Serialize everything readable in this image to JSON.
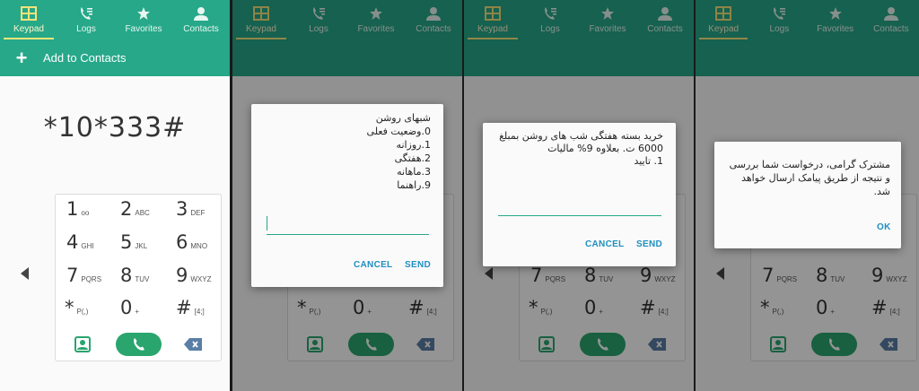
{
  "tabs": [
    {
      "label": "Keypad",
      "icon": "keypad-icon",
      "active": true
    },
    {
      "label": "Logs",
      "icon": "call-log-icon",
      "active": false
    },
    {
      "label": "Favorites",
      "icon": "star-icon",
      "active": false
    },
    {
      "label": "Contacts",
      "icon": "person-icon",
      "active": false
    }
  ],
  "actionbar": {
    "label": "Add to Contacts",
    "icon": "plus-icon"
  },
  "dial_number": "*10*333#",
  "keys": [
    {
      "digit": "1",
      "sub": "ᴏᴏ"
    },
    {
      "digit": "2",
      "sub": "ABC"
    },
    {
      "digit": "3",
      "sub": "DEF"
    },
    {
      "digit": "4",
      "sub": "GHI"
    },
    {
      "digit": "5",
      "sub": "JKL"
    },
    {
      "digit": "6",
      "sub": "MNO"
    },
    {
      "digit": "7",
      "sub": "PQRS"
    },
    {
      "digit": "8",
      "sub": "TUV"
    },
    {
      "digit": "9",
      "sub": "WXYZ"
    },
    {
      "digit": "*",
      "sub": "P(,)"
    },
    {
      "digit": "0",
      "sub": "+"
    },
    {
      "digit": "#",
      "sub": "[4;]"
    }
  ],
  "dialog1": {
    "message": "شبهای روشن\n0.وضعیت فعلی\n1.روزانه\n2.هفتگی\n3.ماهانه\n9.راهنما",
    "cancel": "CANCEL",
    "send": "SEND"
  },
  "dialog2": {
    "message": "خرید بسته هفتگی شب های روشن بمبلغ 6000 ت. بعلاوه 9% مالیات\n1. تایید",
    "cancel": "CANCEL",
    "send": "SEND"
  },
  "dialog3": {
    "message": "مشترک گرامی، درخواست شما بررسی و نتیجه از طریق پیامک ارسال خواهد شد.",
    "ok": "OK"
  },
  "colors": {
    "primary": "#26a889",
    "accent": "#1f8fbf",
    "call": "#2aa56e"
  }
}
